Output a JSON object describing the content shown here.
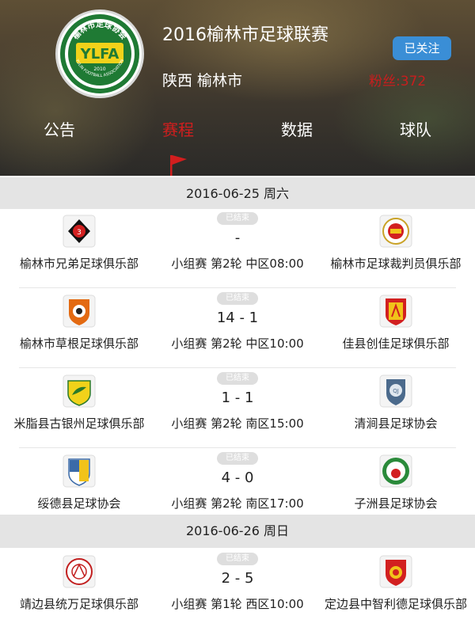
{
  "league": {
    "title": "2016榆林市足球联赛",
    "region": "陕西 榆林市",
    "follow_label": "已关注",
    "fans_label": "粉丝:",
    "fans_count": "372",
    "logo_top_text": "榆林市足球协会",
    "logo_mid_text": "YLFA",
    "logo_bottom_text": "YULIN FOOTBALL ASSOCIATION",
    "logo_year": "2010"
  },
  "tabs": [
    {
      "label": "公告",
      "active": false
    },
    {
      "label": "赛程",
      "active": true
    },
    {
      "label": "数据",
      "active": false
    },
    {
      "label": "球队",
      "active": false
    }
  ],
  "colors": {
    "accent_red": "#d21e1e",
    "follow_blue": "#3a8ed6",
    "date_bar": "#e4e4e4",
    "status_badge": "#dedede"
  },
  "days": [
    {
      "date": "2016-06-25 周六",
      "matches": [
        {
          "status": "已结束",
          "home": "榆林市兄弟足球俱乐部",
          "home_icon": "brothers-club-crest-icon",
          "away": "榆林市足球裁判员俱乐部",
          "away_icon": "referees-club-crest-icon",
          "score": "-",
          "round": "小组赛 第2轮 中区08:00"
        },
        {
          "status": "已结束",
          "home": "榆林市草根足球俱乐部",
          "home_icon": "grassroots-club-crest-icon",
          "away": "佳县创佳足球俱乐部",
          "away_icon": "chuangjia-club-crest-icon",
          "score": "14 - 1",
          "round": "小组赛 第2轮 中区10:00"
        },
        {
          "status": "已结束",
          "home": "米脂县古银州足球俱乐部",
          "home_icon": "guyinzhou-club-crest-icon",
          "away": "清涧县足球协会",
          "away_icon": "qingjian-association-crest-icon",
          "score": "1 - 1",
          "round": "小组赛 第2轮 南区15:00"
        },
        {
          "status": "已结束",
          "home": "绥德县足球协会",
          "home_icon": "suide-association-crest-icon",
          "away": "子洲县足球协会",
          "away_icon": "zizhou-association-crest-icon",
          "score": "4 - 0",
          "round": "小组赛 第2轮 南区17:00"
        }
      ]
    },
    {
      "date": "2016-06-26 周日",
      "matches": [
        {
          "status": "已结束",
          "home": "靖边县统万足球俱乐部",
          "home_icon": "tongwan-club-crest-icon",
          "away": "定边县中智利德足球俱乐部",
          "away_icon": "zhongzhilide-club-crest-icon",
          "score": "2 - 5",
          "round": "小组赛 第1轮 西区10:00"
        }
      ]
    }
  ]
}
